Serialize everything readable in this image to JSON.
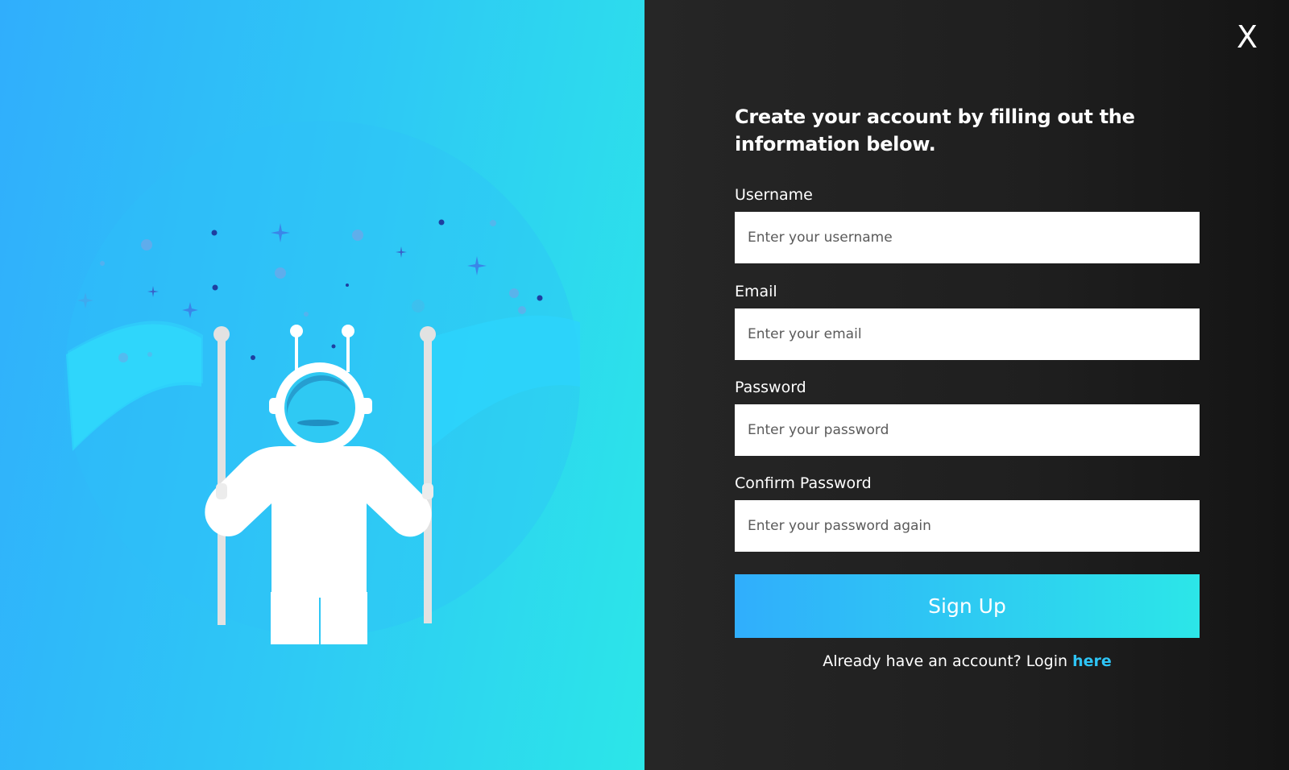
{
  "dialog": {
    "close_label": "X",
    "title": "Create your account by filling out the information below."
  },
  "form": {
    "fields": [
      {
        "label": "Username",
        "placeholder": "Enter your username",
        "value": ""
      },
      {
        "label": "Email",
        "placeholder": "Enter your email",
        "value": ""
      },
      {
        "label": "Password",
        "placeholder": "Enter your password",
        "value": ""
      },
      {
        "label": "Confirm Password",
        "placeholder": "Enter your password again",
        "value": ""
      }
    ],
    "submit_label": "Sign Up",
    "login_prompt": "Already have an account? Login",
    "login_link": "here"
  },
  "illustration": {
    "subject": "astronaut-holding-banner",
    "icons": [
      "astronaut-icon",
      "star-icon",
      "planet-icon",
      "banner-flag-icon"
    ]
  },
  "colors": {
    "gradient_start": "#30aefc",
    "gradient_end": "#2ce6e8",
    "panel_dark": "#1f1f1f",
    "link": "#2ec4f5",
    "input_bg": "#ffffff"
  }
}
